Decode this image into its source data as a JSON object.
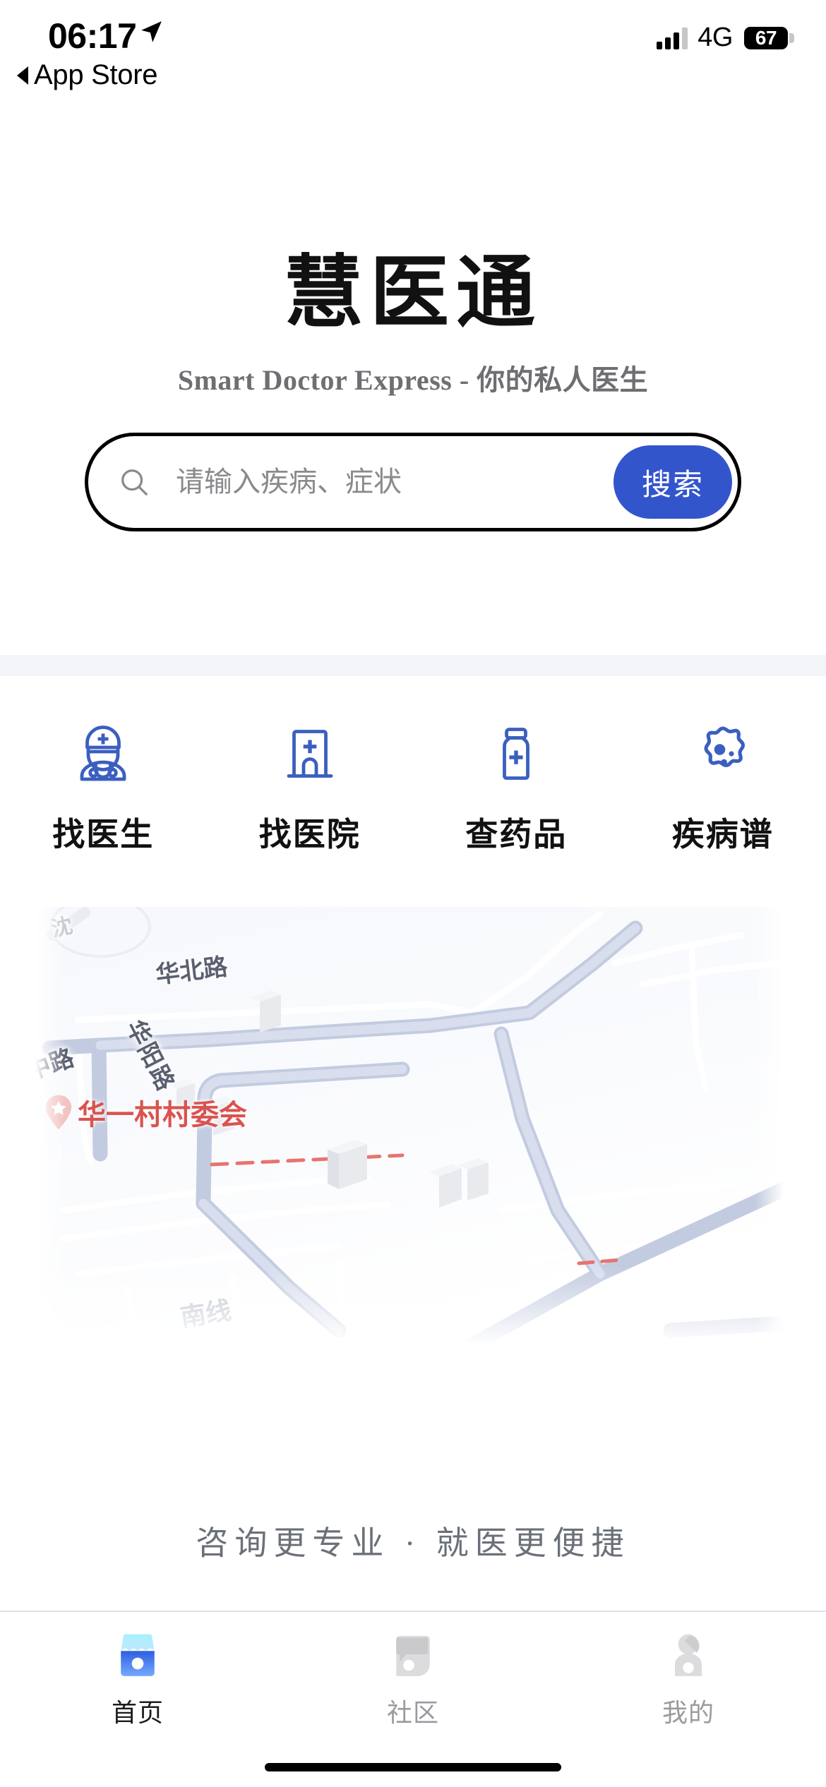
{
  "status_bar": {
    "time": "06:17",
    "location_arrow_icon": "location-arrow-icon",
    "back_label": "App Store",
    "signal_icon": "signal-bars-icon",
    "network": "4G",
    "battery_percent": "67"
  },
  "brand": {
    "title": "慧医通",
    "subtitle": "Smart Doctor Express - 你的私人医生"
  },
  "search": {
    "icon": "search-icon",
    "placeholder": "请输入疾病、症状",
    "value": "",
    "button_label": "搜索",
    "button_color": "#3355CC"
  },
  "quick_actions": [
    {
      "label": "找医生",
      "icon": "doctor-icon"
    },
    {
      "label": "找医院",
      "icon": "hospital-icon"
    },
    {
      "label": "查药品",
      "icon": "medicine-bottle-icon"
    },
    {
      "label": "疾病谱",
      "icon": "virus-icon"
    }
  ],
  "map": {
    "poi_label": "华一村村委会",
    "poi_pin_icon": "map-pin-icon",
    "poi_color": "#D9534F",
    "road_labels": {
      "huabeilu": "华北路",
      "huayanglu": "华阳路",
      "zhonglu": "中路",
      "nanxian": "南线",
      "shen": "沈"
    },
    "road_color": "#C3CBE0"
  },
  "tagline": "咨询更专业 · 就医更便捷",
  "tab_bar": [
    {
      "label": "首页",
      "icon": "storefront-icon",
      "active": true
    },
    {
      "label": "社区",
      "icon": "community-chat-icon",
      "active": false
    },
    {
      "label": "我的",
      "icon": "person-icon",
      "active": false
    }
  ]
}
